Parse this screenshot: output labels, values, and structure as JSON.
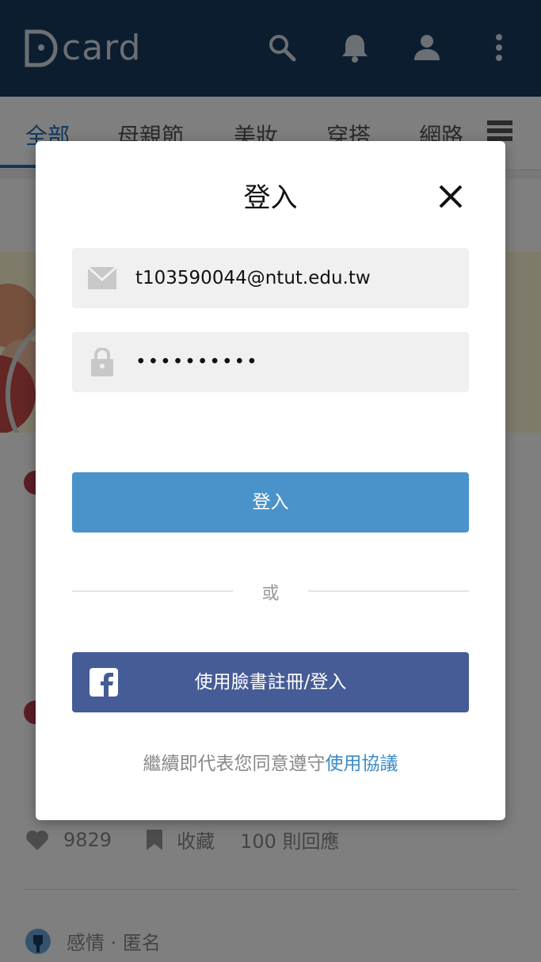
{
  "app": {
    "logo_text": "card"
  },
  "tabs": [
    "全部",
    "母親節",
    "美妝",
    "穿搭",
    "網路"
  ],
  "post": {
    "likes": "9829",
    "save_label": "收藏",
    "replies": "100 則回應",
    "next_meta": "感情 · 匿名"
  },
  "login_dialog": {
    "title": "登入",
    "email_value": "t103590044@ntut.edu.tw",
    "password_value": "••••••••••",
    "login_button": "登入",
    "or_text": "或",
    "facebook_button": "使用臉書註冊/登入",
    "agreement_text": "繼續即代表您同意遵守",
    "agreement_link": "使用協議"
  },
  "colors": {
    "appbar": "#1b3b60",
    "login_button": "#4a93ca",
    "facebook_button": "#465c96",
    "link": "#3a8bc8"
  }
}
